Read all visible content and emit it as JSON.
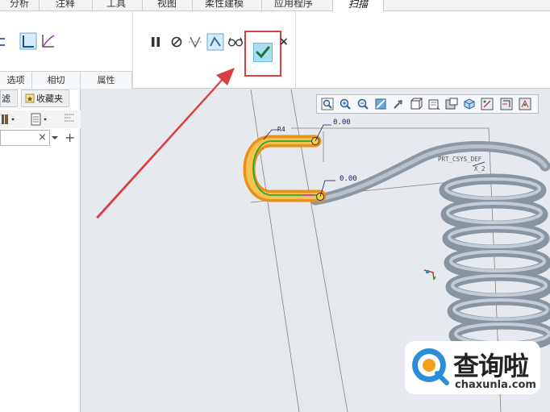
{
  "menu": {
    "tabs": [
      "分析",
      "注释",
      "工具",
      "视图",
      "柔性建模",
      "应用程序",
      "扫描"
    ],
    "active_tab": "扫描"
  },
  "ribbon": {
    "sub_tabs": [
      "选项",
      "相切",
      "属性"
    ],
    "pause_icon": "pause-icon",
    "stop_icon": "no-entry-icon",
    "ok_icon": "check-icon",
    "cancel_label": "×"
  },
  "left_panel": {
    "tabs": [
      "滤器",
      "收藏夹"
    ],
    "search_value": "",
    "clear_label": "×",
    "add_label": "+"
  },
  "viewport": {
    "dim_top": "0.00",
    "dim_mid": "0.00",
    "label_r4": "R4",
    "csys_label": "PRT_CSYS_DEF",
    "axis_label": "X_2"
  },
  "watermark": {
    "text": "查询啦",
    "url": "chaxunla.com"
  },
  "colors": {
    "accent_red": "#d94040",
    "spring_gray": "#8e9aa6",
    "sweep_orange": "#f0a020",
    "ok_blue": "#a9dcf5"
  }
}
